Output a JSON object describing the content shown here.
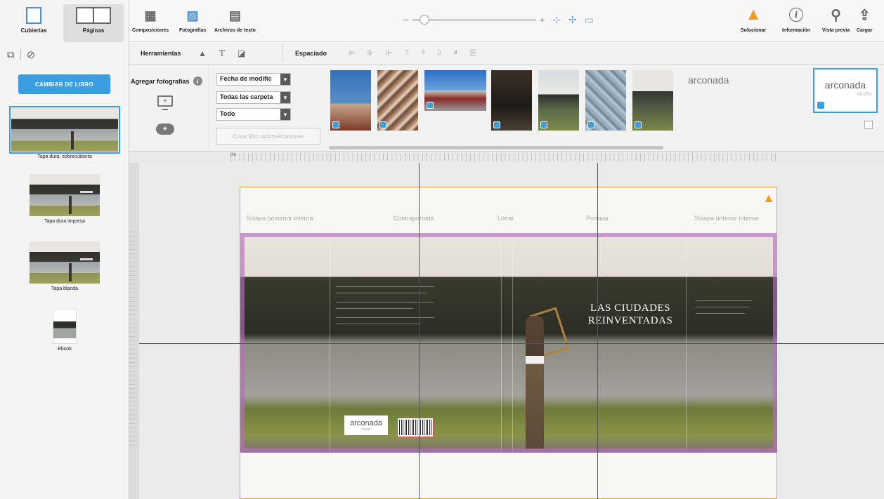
{
  "left_panel": {
    "tabs": [
      {
        "label": "Cubiertas",
        "active": true
      },
      {
        "label": "Páginas",
        "active": false
      }
    ],
    "change_book_button": "CAMBIAR DE LIBRO",
    "covers": [
      {
        "label": "Tapa dura, sobrecubierta",
        "selected": true
      },
      {
        "label": "Tapa dura impresa",
        "selected": false
      },
      {
        "label": "Tapa blanda",
        "selected": false
      },
      {
        "label": "Ebook",
        "selected": false
      }
    ]
  },
  "toolbar": {
    "composiciones": "Composiciones",
    "fotografias": "Fotografías",
    "archivos": "Archivos de texto",
    "zoom_minus": "−",
    "zoom_plus": "+",
    "zoom_level": 0.06,
    "solucionar": "Solucionar",
    "informacion": "Información",
    "vista_previa": "Vista previa",
    "cargar": "Cargar",
    "warning_color": "#f09a25",
    "accent_color": "#3a9ee1"
  },
  "tools_row": {
    "herramientas": "Herramientas",
    "espaciado": "Espaciado"
  },
  "photo_strip": {
    "add_photos": "Agregar fotografías",
    "filter_sort": "Fecha de modific",
    "filter_folder": "Todas las carpeta",
    "filter_type": "Todo",
    "auto_create": "Crear libro automáticamente",
    "text_asset": "arconada",
    "logo_main": "arconada",
    "logo_sub": "studio"
  },
  "canvas": {
    "ruler_zero": "0in",
    "sections": [
      "Solapa posterior interna",
      "Contraportada",
      "Lomo",
      "Portada",
      "Solapa anterior interna"
    ],
    "front_title": "LAS CIUDADES REINVENTADAS",
    "logo_main": "arconada",
    "logo_sub": "studio"
  }
}
